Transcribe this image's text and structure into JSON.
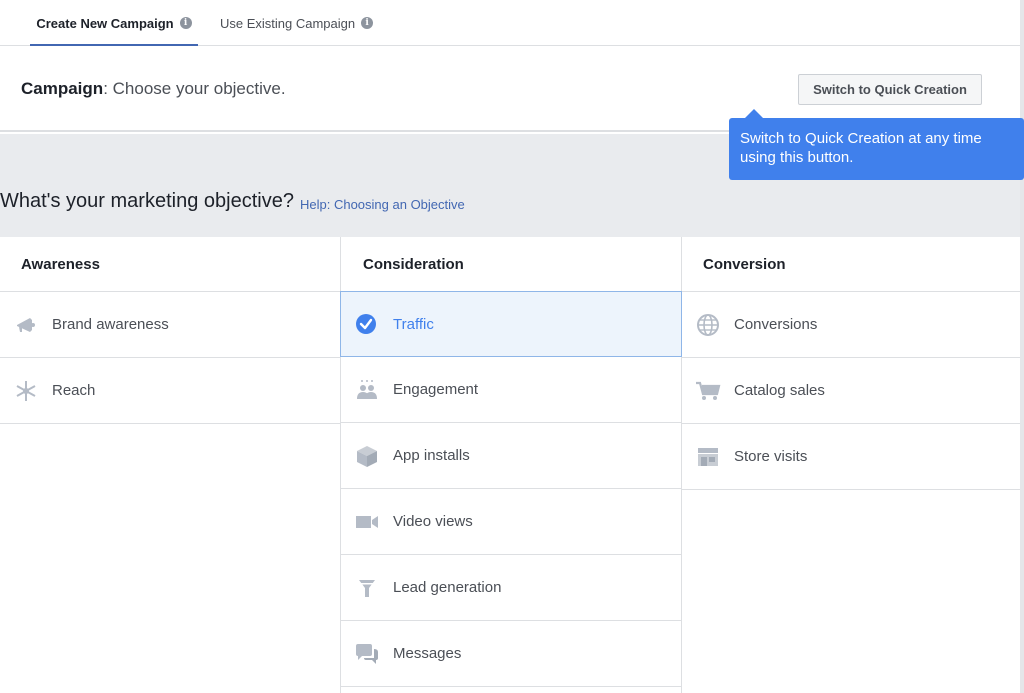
{
  "tabs": {
    "create": "Create New Campaign",
    "existing": "Use Existing Campaign",
    "info_glyph": "i"
  },
  "campaign": {
    "label": "Campaign",
    "prompt": ": Choose your objective.",
    "quick_button": "Switch to Quick Creation"
  },
  "tooltip": {
    "text": "Switch to Quick Creation at any time using this button."
  },
  "objective": {
    "question": "What's your marketing objective?",
    "help": "Help: Choosing an Objective"
  },
  "columns": {
    "awareness": {
      "title": "Awareness",
      "items": [
        {
          "label": "Brand awareness",
          "icon": "megaphone-icon"
        },
        {
          "label": "Reach",
          "icon": "reach-icon"
        }
      ]
    },
    "consideration": {
      "title": "Consideration",
      "items": [
        {
          "label": "Traffic",
          "icon": "check-circle-icon",
          "selected": true
        },
        {
          "label": "Engagement",
          "icon": "people-icon"
        },
        {
          "label": "App installs",
          "icon": "box-icon"
        },
        {
          "label": "Video views",
          "icon": "video-camera-icon"
        },
        {
          "label": "Lead generation",
          "icon": "funnel-icon"
        },
        {
          "label": "Messages",
          "icon": "chat-bubbles-icon"
        }
      ]
    },
    "conversion": {
      "title": "Conversion",
      "items": [
        {
          "label": "Conversions",
          "icon": "globe-icon"
        },
        {
          "label": "Catalog sales",
          "icon": "cart-icon"
        },
        {
          "label": "Store visits",
          "icon": "store-icon"
        }
      ]
    }
  },
  "colors": {
    "accent": "#4080ec",
    "tab_underline": "#4267b2",
    "icon_gray": "#b4bbc6",
    "band": "#e9ebee"
  }
}
